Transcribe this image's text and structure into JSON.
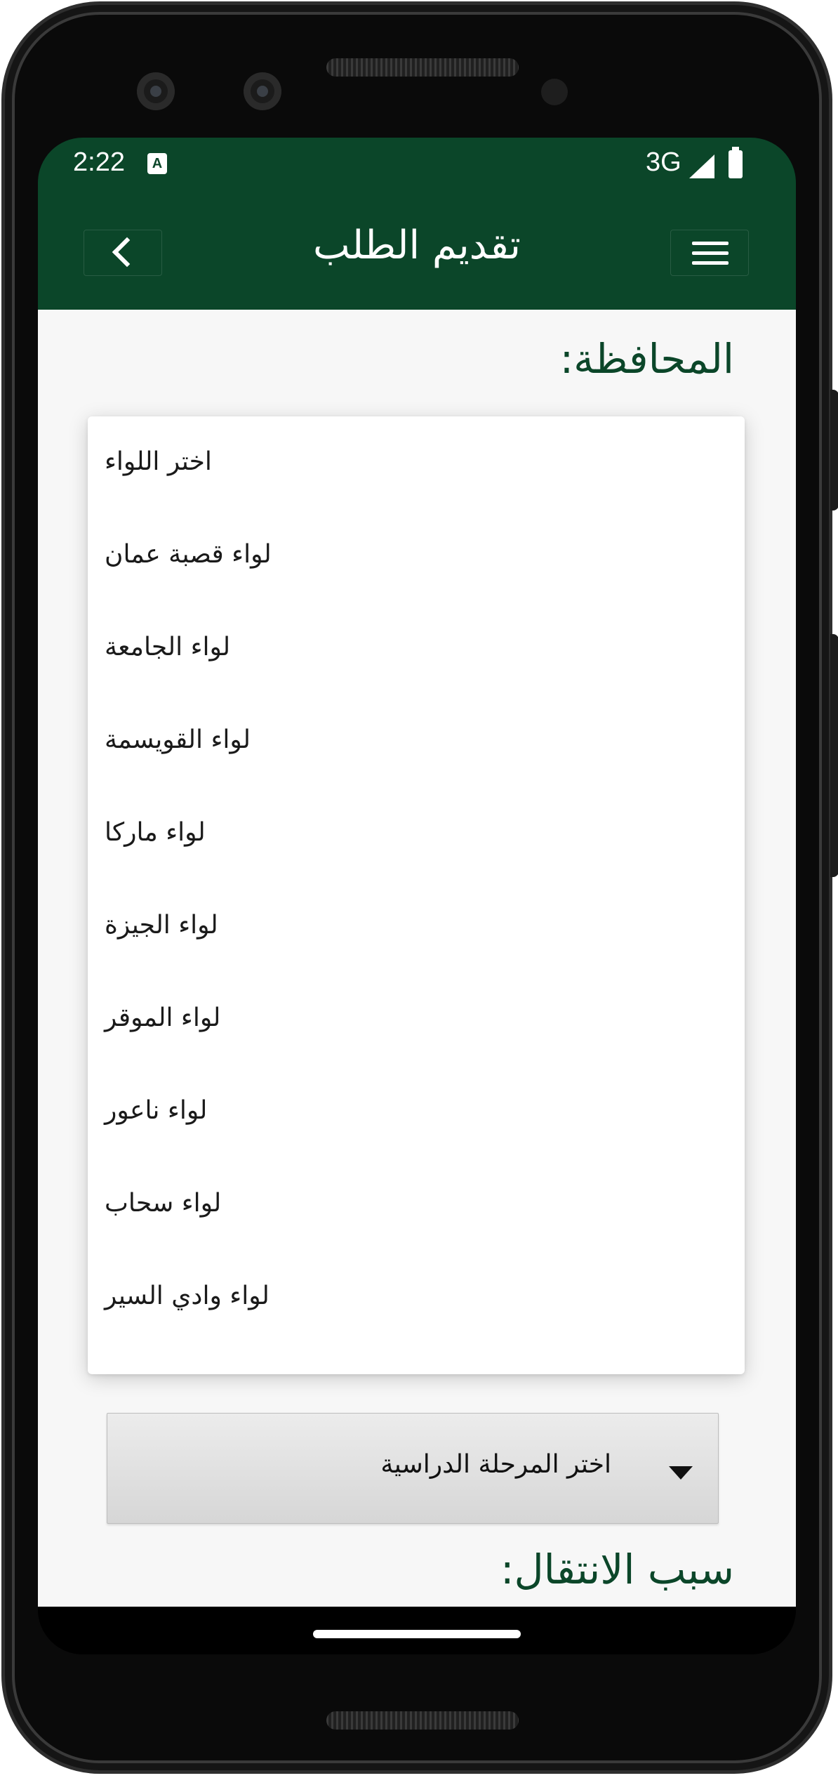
{
  "status_bar": {
    "time": "2:22",
    "notification_icon": "a-icon",
    "network": "3G",
    "signal_icon": "signal-icon",
    "battery_icon": "battery-icon"
  },
  "app_bar": {
    "title": "تقديم الطلب",
    "back_icon": "chevron-left-icon",
    "menu_icon": "hamburger-menu-icon",
    "background_color": "#0b4629"
  },
  "form": {
    "governorate_label": "المحافظة:",
    "district_options": [
      "اختر اللواء",
      "لواء قصبة عمان",
      "لواء الجامعة",
      "لواء القويسمة",
      "لواء ماركا",
      "لواء الجيزة",
      "لواء الموقر",
      "لواء ناعور",
      "لواء سحاب",
      "لواء وادي السير"
    ],
    "stage_select": {
      "value": "اختر المرحلة الدراسية",
      "icon": "dropdown-arrow-icon"
    },
    "transfer_reason_label": "سبب الانتقال:",
    "label_color": "#0b4629"
  }
}
